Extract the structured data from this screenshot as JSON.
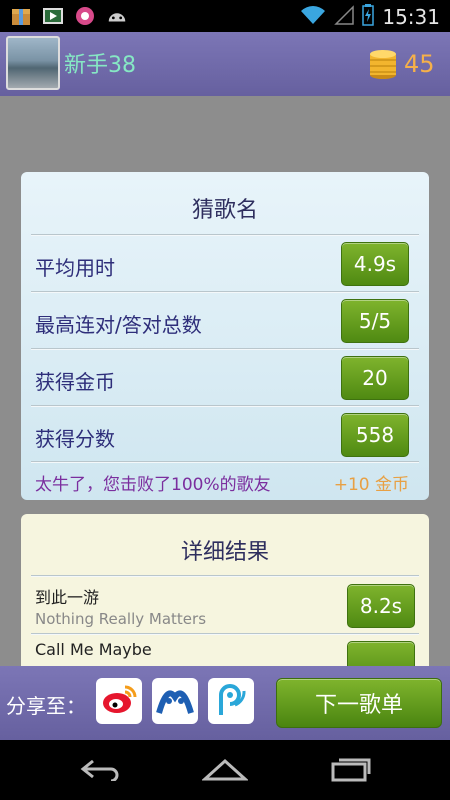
{
  "status_bar": {
    "time": "15:31",
    "icons_left": [
      "package-icon",
      "video-icon",
      "flower-icon",
      "android-icon"
    ],
    "icons_right": [
      "wifi-icon",
      "signal-icon",
      "battery-icon"
    ]
  },
  "header": {
    "username": "新手38",
    "coins": "45"
  },
  "result_card": {
    "title": "猜歌名",
    "rows": [
      {
        "label": "平均用时",
        "value": "4.9s"
      },
      {
        "label": "最高连对/答对总数",
        "value": "5/5"
      },
      {
        "label": "获得金币",
        "value": "20"
      },
      {
        "label": "获得分数",
        "value": "558"
      }
    ],
    "message": "太牛了，您击败了100%的歌友",
    "bonus": "+10 金币"
  },
  "detail_card": {
    "title": "详细结果",
    "songs": [
      {
        "title": "到此一游",
        "artist": "Nothing Really Matters",
        "time": "8.2s"
      },
      {
        "title": "Call Me Maybe",
        "artist": "",
        "time": ""
      }
    ]
  },
  "bottom_bar": {
    "share_label": "分享至：",
    "share_targets": [
      "weibo-icon",
      "renren-icon",
      "qq-weibo-icon"
    ],
    "next_label": "下一歌单"
  },
  "colors": {
    "header_bg": "#726cab",
    "username": "#86e8c4",
    "coins": "#f5b04a",
    "badge_green": "#5f9a1a",
    "message_purple": "#7b2e9e",
    "bonus_orange": "#e8a043"
  }
}
